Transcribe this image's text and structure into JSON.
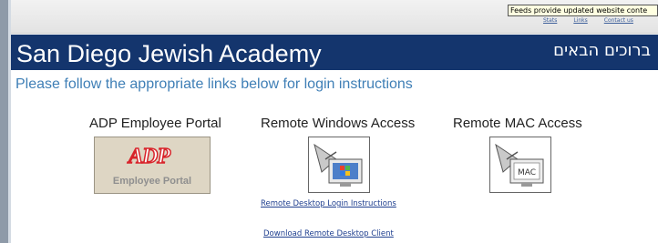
{
  "browser": {
    "tooltip": "Feeds provide updated website conte",
    "top_links": [
      "Stats",
      "Links",
      "Contact us"
    ]
  },
  "header": {
    "title": "San Diego Jewish Academy",
    "hebrew": "ברוכים הבאים",
    "bg_color": "#14356d"
  },
  "instructions": "Please follow the appropriate links below for login instructions",
  "portals": {
    "adp": {
      "label": "ADP Employee Portal",
      "logo_text": "ADP",
      "sub_text": "Employee Portal",
      "logo_color": "#d8232a"
    },
    "windows": {
      "label": "Remote Windows Access",
      "icon": "remote-desktop-windows-icon",
      "links": [
        "Remote Desktop Login Instructions",
        "Download Remote Desktop Client"
      ]
    },
    "mac": {
      "label": "Remote MAC Access",
      "icon": "remote-desktop-mac-icon",
      "badge": "MAC"
    }
  }
}
